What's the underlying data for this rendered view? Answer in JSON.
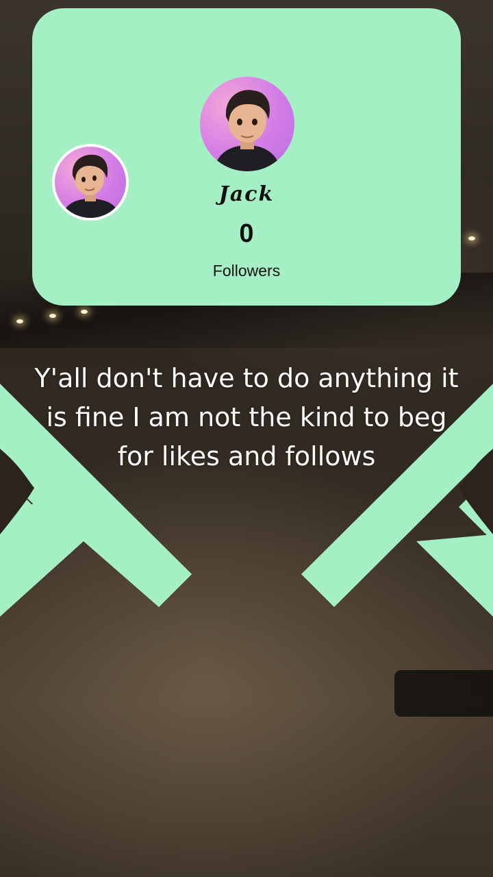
{
  "profile": {
    "name": "Jack",
    "count": "0",
    "followers_label": "Followers"
  },
  "caption": "Y'all don't have to do anything it is fine I am not the kind to beg for likes and follows",
  "colors": {
    "card": "#a5efc4",
    "x_shape": "#a5efc4",
    "text": "#111111",
    "caption": "#ffffff"
  },
  "icons": [
    "avatar-image",
    "x-decoration-left",
    "x-decoration-right"
  ]
}
